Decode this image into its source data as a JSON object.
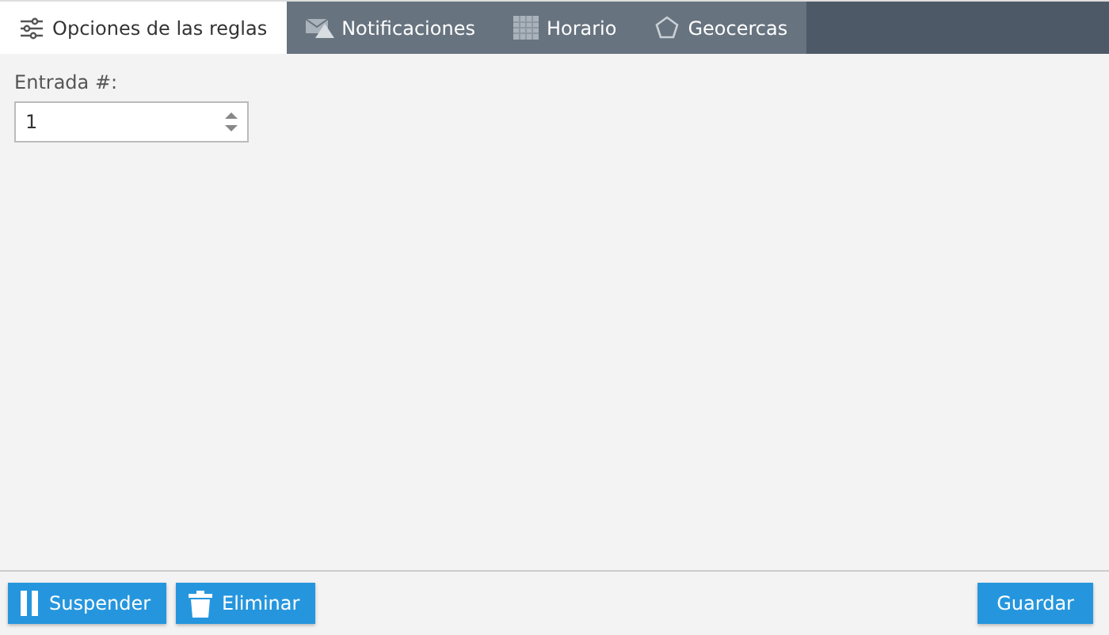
{
  "tabs": [
    {
      "label": "Opciones de las reglas",
      "selected": true
    },
    {
      "label": "Notificaciones",
      "selected": false
    },
    {
      "label": "Horario",
      "selected": false
    },
    {
      "label": "Geocercas",
      "selected": false
    }
  ],
  "field": {
    "label": "Entrada #:",
    "value": "1"
  },
  "buttons": [
    {
      "label": "Suspender",
      "kind": "suspend"
    },
    {
      "label": "Eliminar",
      "kind": "delete"
    },
    {
      "label": "Guardar",
      "kind": "save"
    }
  ]
}
